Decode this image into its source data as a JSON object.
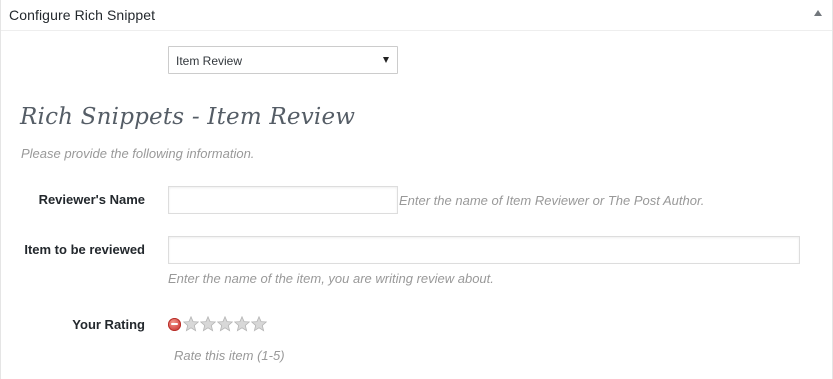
{
  "metabox": {
    "title": "Configure Rich Snippet"
  },
  "type_select": {
    "selected": "Item Review"
  },
  "section": {
    "heading": "Rich Snippets - Item Review",
    "description": "Please provide the following information."
  },
  "fields": {
    "reviewer_name": {
      "label": "Reviewer's Name",
      "value": "",
      "hint": "Enter the name of Item Reviewer or The Post Author."
    },
    "item_reviewed": {
      "label": "Item to be reviewed",
      "value": "",
      "hint": "Enter the name of the item, you are writing review about."
    },
    "rating": {
      "label": "Your Rating",
      "value": 0,
      "max": 5,
      "hint": "Rate this item (1-5)"
    }
  },
  "icons": {
    "collapse": "triangle-up-icon",
    "select_caret": "caret-down-icon",
    "cancel": "cancel-rating-icon",
    "star": "star-icon"
  },
  "colors": {
    "cancel_red": "#d9534f",
    "star_empty": "#d8d8d8",
    "hint_text": "#999999",
    "heading_text": "#555d66"
  }
}
